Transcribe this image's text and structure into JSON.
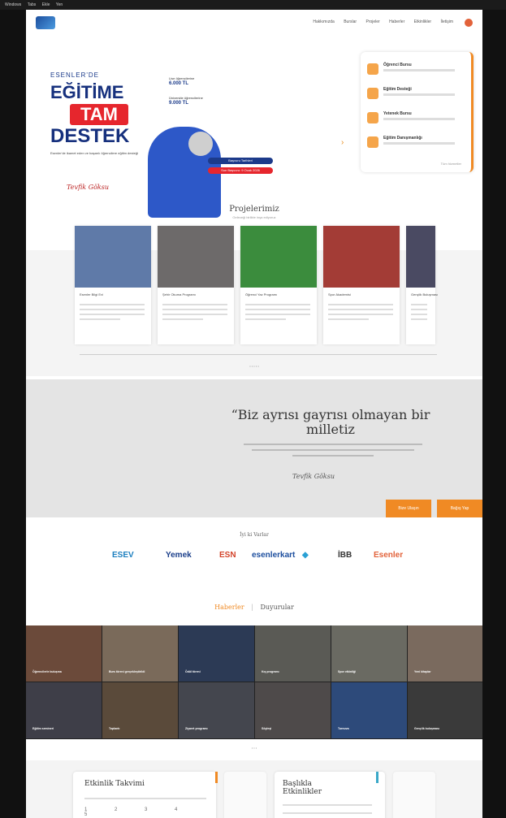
{
  "topbar": {
    "items": [
      "Windows",
      "Tabs",
      "Ekle",
      "Yen"
    ]
  },
  "header": {
    "nav": [
      "Hakkımızda",
      "Burslar",
      "Projeler",
      "Haberler",
      "Etkinlikler",
      "İletişim"
    ]
  },
  "hero": {
    "top": "ESENLER'DE",
    "title1": "EĞİTİME",
    "title2": "TAM",
    "title3": "DESTEK",
    "desc": "Esenler'de ikamet eden ve başarılı öğrencilere eğitim desteği",
    "signature": "Tevfik Göksu",
    "grant1_label": "Lise öğrencilerine",
    "grant1_amount": "6.000 TL",
    "grant2_label": "Üniversite öğrencilerine",
    "grant2_amount": "9.000 TL",
    "pill1": "Başvuru Tarihleri",
    "pill2": "Son Başvuru: 9 Ocak 2026"
  },
  "panel": {
    "items": [
      "Öğrenci Bursu",
      "Eğitim Desteği",
      "Yetenek Bursu",
      "Eğitim Danışmanlığı"
    ],
    "more": "Tüm hizmetler"
  },
  "projects": {
    "title": "Projelerimiz",
    "subtitle": "Geleceği birlikte inşa ediyoruz",
    "cards": [
      {
        "title": "Esenler Bilgi Evi",
        "color": "#5f7aa8"
      },
      {
        "title": "Şehir Okuma Programı",
        "color": "#6d6a6a"
      },
      {
        "title": "Öğrenci Yaz Programı",
        "color": "#3b8c3d"
      },
      {
        "title": "Spor Akademisi",
        "color": "#a33c36"
      },
      {
        "title": "Gençlik Buluşması",
        "color": "#4a4a62"
      }
    ],
    "dots": "• • • • •"
  },
  "quote": {
    "text": "“Biz ayrısı gayrısı olmayan bir milletiz",
    "signature": "Tevfik Göksu",
    "button1": "Bize Ulaşın",
    "button2": "Bağış Yap"
  },
  "partners": {
    "title": "İyi ki Varlar",
    "logos": [
      {
        "name": "ESEV",
        "color": "#1c7fbf"
      },
      {
        "name": "Yemek",
        "color": "#1a3e8a"
      },
      {
        "name": "ESN",
        "color": "#d3432a"
      },
      {
        "name": "esenlerkart",
        "color": "#1c4e9e"
      },
      {
        "name": "◆",
        "color": "#2aa0d4"
      },
      {
        "name": "İBB",
        "color": "#333333"
      },
      {
        "name": "Esenler",
        "color": "#e2623a"
      }
    ]
  },
  "tabs": {
    "news": "Haberler",
    "sep": "|",
    "announcements": "Duyurular"
  },
  "news": {
    "tiles": [
      {
        "caption": "Öğrencilerle buluşma",
        "color": "#6b4a3a"
      },
      {
        "caption": "Burs töreni gerçekleştirildi",
        "color": "#7a6a5a"
      },
      {
        "caption": "Ödül töreni",
        "color": "#2c3a55"
      },
      {
        "caption": "Kış programı",
        "color": "#5a5a55"
      },
      {
        "caption": "Spor etkinliği",
        "color": "#6a6a62"
      },
      {
        "caption": "Yeni kitaplar",
        "color": "#7a6a5e"
      },
      {
        "caption": "Eğitim semineri",
        "color": "#3e3e48"
      },
      {
        "caption": "Toplantı",
        "color": "#5a4a3a"
      },
      {
        "caption": "Ziyaret programı",
        "color": "#44464e"
      },
      {
        "caption": "Söyleşi",
        "color": "#4e4a4a"
      },
      {
        "caption": "Turnuva",
        "color": "#2d4a7a"
      },
      {
        "caption": "Gençlik buluşması",
        "color": "#3a3a3a"
      }
    ]
  },
  "pager": "• • •",
  "events": {
    "calendar_title": "Etkinlik Takvimi",
    "announce_title": "Başlıkla Etkinlikler"
  }
}
